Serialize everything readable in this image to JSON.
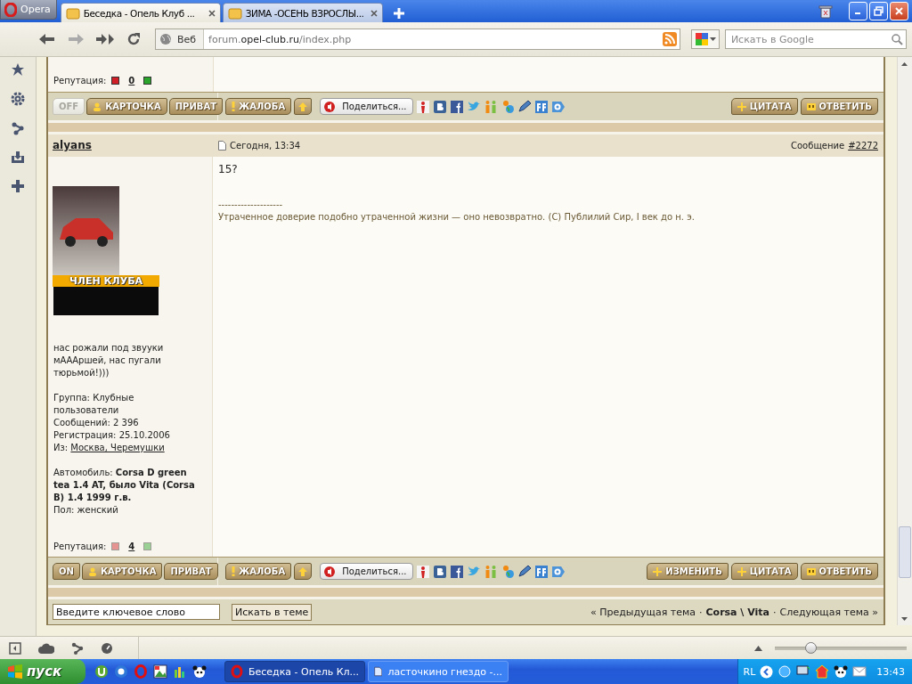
{
  "browser": {
    "menu_button": "Opera",
    "tabs": [
      {
        "title": "Беседка - Опель Клуб ...",
        "selected": true
      },
      {
        "title": "ЗИМА -ОСЕНЬ ВЗРОСЛЫ...",
        "selected": false
      }
    ],
    "address_bar": {
      "label": "Веб",
      "url": {
        "prefix": "forum.",
        "domain": "opel-club.ru",
        "path": "/index.php"
      }
    },
    "search": {
      "placeholder": "Искать в Google"
    }
  },
  "previous_post": {
    "reputation": {
      "label": "Репутация:",
      "value": "0",
      "voting_enabled": true
    },
    "actions": {
      "toggle": {
        "label": "OFF",
        "on": false
      },
      "left_buttons": [
        {
          "label": "КАРТОЧКА",
          "kind": "profile"
        },
        {
          "label": "ПРИВАТ",
          "kind": "plain"
        }
      ],
      "report": "ЖАЛОБА",
      "share": "Поделиться...",
      "right_buttons": [
        {
          "label": "ЦИТАТА",
          "kind": "add"
        },
        {
          "label": "ОТВЕТИТЬ",
          "kind": "quote"
        }
      ]
    }
  },
  "post": {
    "author": "alyans",
    "date": "Сегодня, 13:34",
    "message_label": "Сообщение",
    "message_number": "#2272",
    "avatar_banner": "ЧЛЕН КЛУБА",
    "status": "нас рожали под звууки мАААршей, нас пугали тюрьмой!)))",
    "profile_sections": [
      [
        {
          "label": "Группа:",
          "value": "Клубные пользователи",
          "kind": "plain"
        },
        {
          "label": "Сообщений:",
          "value": "2 396",
          "kind": "plain"
        },
        {
          "label": "Регистрация:",
          "value": "25.10.2006",
          "kind": "plain"
        },
        {
          "label": "Из:",
          "value": "Москва, Черемушки",
          "kind": "link"
        }
      ],
      [
        {
          "label": "Автомобиль:",
          "value": "Corsa D green tea 1.4 AT, было Vita (Corsa B) 1.4 1999 г.в.",
          "kind": "bold"
        },
        {
          "label": "Пол:",
          "value": "женский",
          "kind": "plain"
        }
      ]
    ],
    "text": "15?",
    "signature_rule": "--------------------",
    "signature": "Утраченное доверие подобно утраченной жизни — оно невозвратно. (C) Публилий Сир, I век до н. э.",
    "reputation": {
      "label": "Репутация:",
      "value": "4",
      "voting_enabled": false
    },
    "actions": {
      "toggle": {
        "label": "ON",
        "on": true
      },
      "left_buttons": [
        {
          "label": "КАРТОЧКА",
          "kind": "profile"
        },
        {
          "label": "ПРИВАТ",
          "kind": "plain"
        }
      ],
      "report": "ЖАЛОБА",
      "share": "Поделиться...",
      "right_buttons": [
        {
          "label": "ИЗМЕНИТЬ",
          "kind": "add"
        },
        {
          "label": "ЦИТАТА",
          "kind": "add"
        },
        {
          "label": "ОТВЕТИТЬ",
          "kind": "quote"
        }
      ]
    }
  },
  "forum_footer": {
    "search_placeholder": "Введите ключевое слово",
    "search_button": "Искать в теме",
    "topic_nav": [
      {
        "text": "« Предыдущая тема",
        "kind": "link"
      },
      {
        "text": "·",
        "kind": "separator"
      },
      {
        "text": "Corsa \\ Vita",
        "kind": "current"
      },
      {
        "text": "·",
        "kind": "separator"
      },
      {
        "text": "Следующая тема »",
        "kind": "link"
      }
    ]
  },
  "status_bar": {
    "zoom_slider": {
      "level": 0.28
    }
  },
  "taskbar": {
    "start": "пуск",
    "tasks": [
      {
        "title": "Беседка - Опель Кл...",
        "selected": true
      },
      {
        "title": "ласточкино гнездо -...",
        "selected": false
      }
    ],
    "language": "RL",
    "clock": "13:43"
  }
}
